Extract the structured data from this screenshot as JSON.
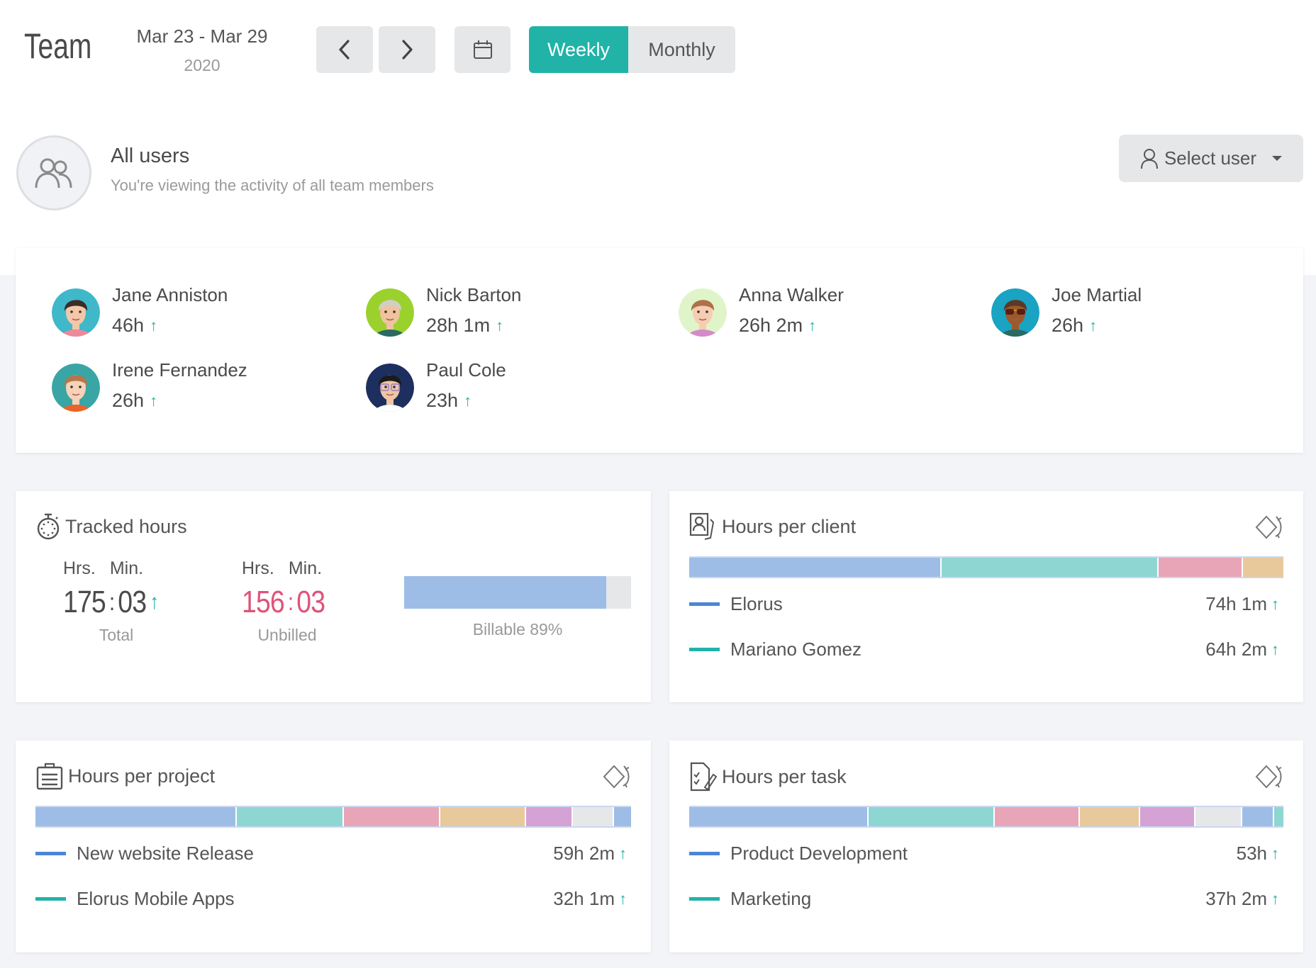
{
  "header": {
    "title": "Team",
    "date_range": "Mar 23 - Mar 29",
    "year": "2020",
    "view_options": [
      "Weekly",
      "Monthly"
    ],
    "active_view": "Weekly"
  },
  "colors": {
    "accent": "#21b3a7",
    "unbilled": "#e0527a",
    "segments": [
      "#9dbde6",
      "#8dd6d2",
      "#e8a5b7",
      "#e8c99b",
      "#d4a2d5",
      "#e6e7e9"
    ],
    "legend": [
      "#4a86d6",
      "#21b3a7"
    ]
  },
  "user_filter": {
    "title": "All users",
    "subtitle": "You're viewing the activity of all team members",
    "select_label": "Select user"
  },
  "members": [
    {
      "name": "Jane Anniston",
      "hours": "46h",
      "trend": "up",
      "avatar": "female-black-hair-teal-bg"
    },
    {
      "name": "Nick Barton",
      "hours": "28h 1m",
      "trend": "up",
      "avatar": "male-gray-hair-green-bg"
    },
    {
      "name": "Anna Walker",
      "hours": "26h 2m",
      "trend": "up",
      "avatar": "female-brown-hair-lightgreen-bg"
    },
    {
      "name": "Joe Martial",
      "hours": "26h",
      "trend": "up",
      "avatar": "male-sunglasses-blue-bg"
    },
    {
      "name": "Irene Fernandez",
      "hours": "26h",
      "trend": "up",
      "avatar": "female-curly-hair-teal-bg"
    },
    {
      "name": "Paul Cole",
      "hours": "23h",
      "trend": "up",
      "avatar": "male-glasses-navy-bg"
    }
  ],
  "tracked": {
    "title": "Tracked hours",
    "hrs_label": "Hrs.",
    "min_label": "Min.",
    "total": {
      "hours": "175",
      "minutes": "03",
      "caption": "Total",
      "trend": "up"
    },
    "unbilled": {
      "hours": "156",
      "minutes": "03",
      "caption": "Unbilled"
    },
    "billable_percent": 89,
    "billable_label": "Billable 89%"
  },
  "client": {
    "title": "Hours per client",
    "segments": [
      42.5,
      36.5,
      14.2,
      6.8
    ],
    "legend": [
      {
        "name": "Elorus",
        "value": "74h 1m",
        "trend": "up"
      },
      {
        "name": "Mariano Gomez",
        "value": "64h 2m",
        "trend": "up"
      }
    ]
  },
  "project": {
    "title": "Hours per project",
    "segments": [
      33.8,
      18,
      16.2,
      14.4,
      7.8,
      7,
      2.8
    ],
    "segment_colors": [
      0,
      1,
      2,
      3,
      4,
      5,
      0
    ],
    "legend": [
      {
        "name": "New website Release",
        "value": "59h 2m",
        "trend": "up"
      },
      {
        "name": "Elorus Mobile Apps",
        "value": "32h 1m",
        "trend": "up"
      }
    ]
  },
  "task": {
    "title": "Hours per task",
    "segments": [
      30.2,
      21.2,
      14.3,
      10.2,
      9.3,
      7.9,
      5.3,
      1.6
    ],
    "segment_colors": [
      0,
      1,
      2,
      3,
      4,
      5,
      0,
      1
    ],
    "legend": [
      {
        "name": "Product Development",
        "value": "53h",
        "trend": "up"
      },
      {
        "name": "Marketing",
        "value": "37h 2m",
        "trend": "up"
      }
    ]
  }
}
